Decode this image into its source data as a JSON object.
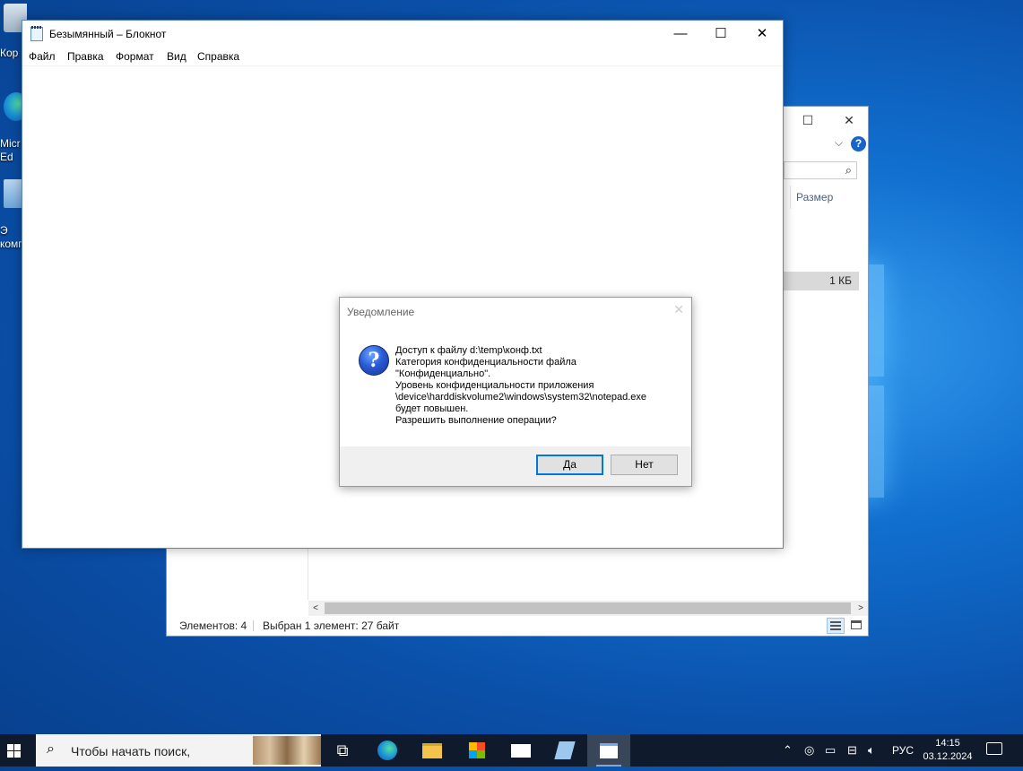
{
  "desktop": {
    "icons": [
      {
        "label": "Кор"
      },
      {
        "label": "Micr\nEd"
      },
      {
        "label": "Э\nкомп"
      }
    ]
  },
  "explorer": {
    "column_size": "Размер",
    "selected_size": "1 КБ",
    "status_items": "Элементов: 4",
    "status_selected": "Выбран 1 элемент: 27 байт"
  },
  "notepad": {
    "title": "Безымянный – Блокнот",
    "menu": [
      "Файл",
      "Правка",
      "Формат",
      "Вид",
      "Справка"
    ],
    "content": ""
  },
  "dialog": {
    "title": "Уведомление",
    "icon": "question-icon",
    "message_lines": [
      "Доступ к файлу d:\\temp\\конф.txt",
      "Категория конфиденциальности файла",
      "\"Конфиденциально\".",
      "Уровень конфиденциальности приложения",
      "\\device\\harddiskvolume2\\windows\\system32\\notepad.exe",
      "будет повышен.",
      "Разрешить выполнение операции?"
    ],
    "yes_label": "Да",
    "no_label": "Нет"
  },
  "taskbar": {
    "search_placeholder": "Чтобы начать поиск,",
    "language": "РУС",
    "time": "14:15",
    "date": "03.12.2024",
    "apps": [
      "task-view",
      "edge",
      "file-explorer",
      "store",
      "mail",
      "notepad-pinned",
      "notepad-running"
    ]
  },
  "colors": {
    "accent": "#0078d7",
    "taskbar": "#0f1a2c",
    "desktop": "#0a4fa8"
  }
}
